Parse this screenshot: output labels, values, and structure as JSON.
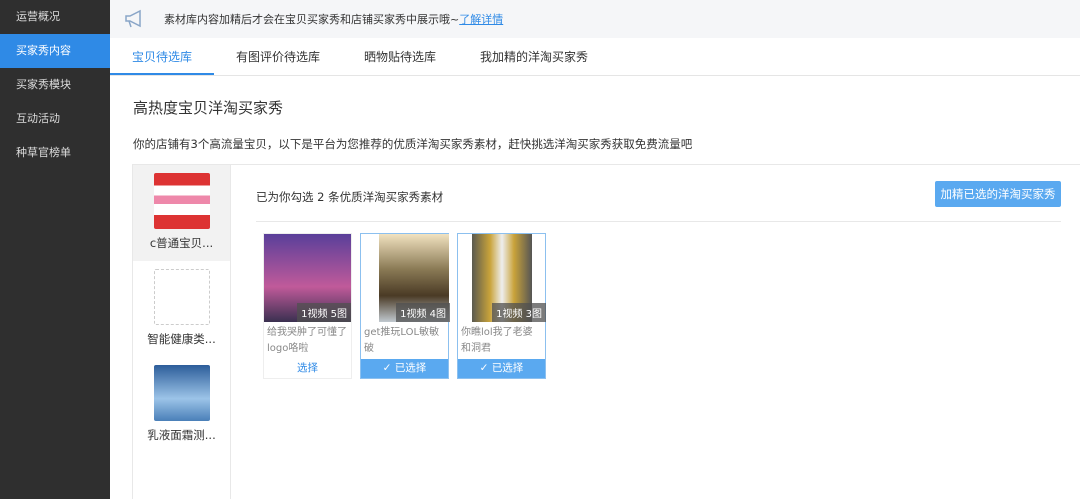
{
  "sidebar": {
    "items": [
      {
        "label": "运营概况"
      },
      {
        "label": "买家秀内容"
      },
      {
        "label": "买家秀模块"
      },
      {
        "label": "互动活动"
      },
      {
        "label": "种草官榜单"
      }
    ]
  },
  "notice": {
    "icon": "megaphone-icon",
    "text": "素材库内容加精后才会在宝贝买家秀和店铺买家秀中展示哦~",
    "link": "了解详情"
  },
  "tabs": [
    {
      "label": "宝贝待选库"
    },
    {
      "label": "有图评价待选库"
    },
    {
      "label": "晒物贴待选库"
    },
    {
      "label": "我加精的洋淘买家秀"
    }
  ],
  "title": "高热度宝贝洋淘买家秀",
  "desc": "你的店铺有3个高流量宝贝，以下是平台为您推荐的优质洋淘买家秀素材，赶快挑选洋淘买家秀获取免费流量吧",
  "products": [
    {
      "label": "c普通宝贝..."
    },
    {
      "label": "智能健康类..."
    },
    {
      "label": "乳液面霜测..."
    }
  ],
  "selected_text": "已为你勾选 2 条优质洋淘买家秀素材",
  "add_button": "加精已选的洋淘买家秀",
  "cards": [
    {
      "badge": "1视频 5图",
      "text": "给我哭肿了可懂了logo咯啦",
      "button": "选择",
      "selected": false
    },
    {
      "badge": "1视频 4图",
      "text": "get推玩LOL敏敏破",
      "button": "已选择",
      "selected": true
    },
    {
      "badge": "1视频 3图",
      "text": "你瞧lol我了老婆和洞君",
      "button": "已选择",
      "selected": true
    }
  ],
  "colors": {
    "accent": "#2f8ae6",
    "button": "#5aa9f0",
    "sidebar": "#2f2f2f"
  }
}
